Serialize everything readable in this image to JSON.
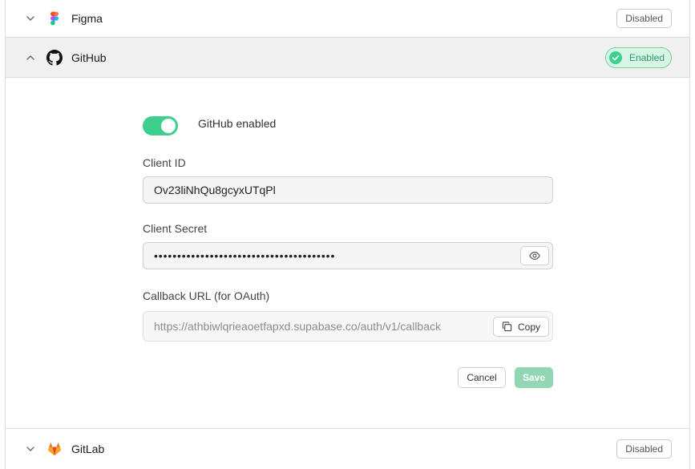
{
  "providers": {
    "figma": {
      "name": "Figma",
      "status": "Disabled",
      "icon": "figma-icon"
    },
    "github": {
      "name": "GitHub",
      "status": "Enabled",
      "icon": "github-icon"
    },
    "gitlab": {
      "name": "GitLab",
      "status": "Disabled",
      "icon": "gitlab-icon"
    }
  },
  "github_panel": {
    "toggle_label": "GitHub enabled",
    "toggle_on": true,
    "client_id_label": "Client ID",
    "client_id_value": "Ov23liNhQu8gcyxUTqPl",
    "client_secret_label": "Client Secret",
    "client_secret_value": "•••••••••••••••••••••••••••••••••••••••",
    "callback_label": "Callback URL (for OAuth)",
    "callback_value": "https://athbiwlqrieaoetfapxd.supabase.co/auth/v1/callback",
    "copy_label": "Copy",
    "cancel_label": "Cancel",
    "save_label": "Save"
  },
  "colors": {
    "accent": "#3ecf8e",
    "enabled_badge_bg": "#d6f5e6",
    "save_disabled": "#92d7b4"
  }
}
